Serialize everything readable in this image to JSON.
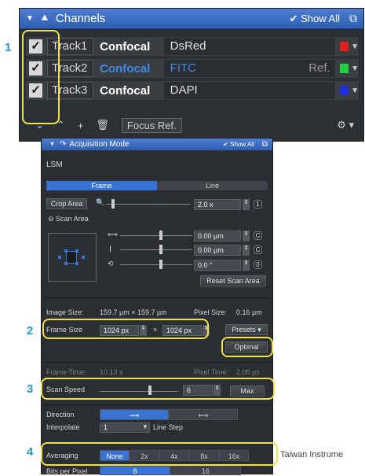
{
  "channels": {
    "title": "Channels",
    "show_all": "Show All",
    "tracks": [
      {
        "track": "Track1",
        "mode": "Confocal",
        "dye": "DsRed",
        "ref": "",
        "color": "#e02020"
      },
      {
        "track": "Track2",
        "mode": "Confocal",
        "dye": "FITC",
        "ref": "Ref.",
        "color": "#20d040"
      },
      {
        "track": "Track3",
        "mode": "Confocal",
        "dye": "DAPI",
        "ref": "",
        "color": "#1e2ee0"
      }
    ],
    "focus_ref": "Focus Ref."
  },
  "acq": {
    "title": "Acquisition Mode",
    "show_all": "Show All",
    "lsm": "LSM",
    "tab_frame": "Frame",
    "tab_line": "Line",
    "crop_area": "Crop Area",
    "zoom": "2.0 x",
    "zoom_btn": "1",
    "scan_area": "Scan Area",
    "offset_x": "0.00 µm",
    "offset_y": "0.00 µm",
    "rotation": "0.0 °",
    "btn_c1": "C",
    "btn_c2": "C",
    "btn_0": "0",
    "reset_scan_area": "Reset Scan Area",
    "image_size_label": "Image Size:",
    "image_size": "159.7 µm × 159.7 µm",
    "pixel_size_label": "Pixel Size:",
    "pixel_size": "0.16 µm",
    "frame_size_label": "Frame Size",
    "frame_x": "1024 px",
    "times": "×",
    "frame_y": "1024 px",
    "presets": "Presets ▾",
    "optimal": "Optimal",
    "frame_time_label": "Frame Time:",
    "frame_time": "10.13 s",
    "pixel_time_label": "Pixel Time:",
    "pixel_time": "2.06 µs",
    "scan_speed_label": "Scan Speed",
    "scan_speed": "6",
    "max": "Max",
    "direction_label": "Direction",
    "interpolate_label": "Interpolate",
    "interpolate": "1",
    "line_step": "Line Step",
    "averaging_label": "Averaging",
    "averaging_options": [
      "None",
      "2x",
      "4x",
      "8x",
      "16x"
    ],
    "averaging_selected": "None",
    "bits_label": "Bits per Pixel",
    "bits_options": [
      "8",
      "16"
    ]
  },
  "callouts": [
    "1",
    "2",
    "3",
    "4"
  ],
  "footer": "Taiwan Instrume",
  "header_partial": "‘’‘’‘’‘’"
}
